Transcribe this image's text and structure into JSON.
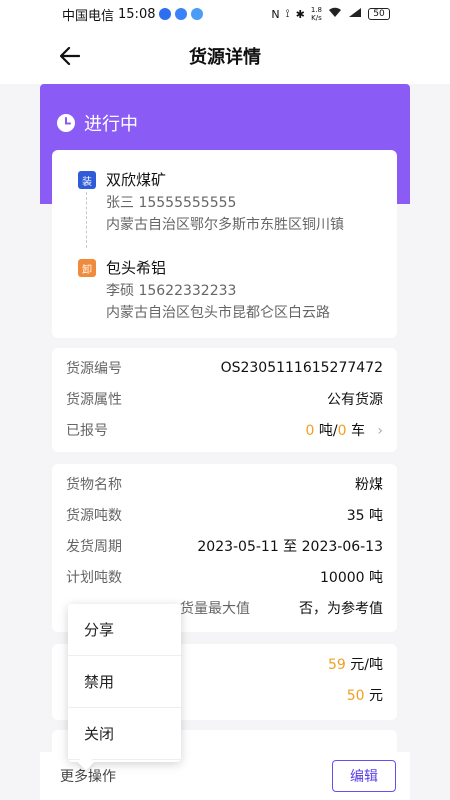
{
  "statusbar": {
    "carrier": "中国电信",
    "time": "15:08",
    "net_speed_top": "1.8",
    "net_speed_bottom": "K/s",
    "battery": "50"
  },
  "header": {
    "title": "货源详情"
  },
  "status": {
    "label": "进行中",
    "banner_color": "#8a5cf5"
  },
  "route": {
    "load": {
      "tag": "装",
      "name": "双欣煤矿",
      "contact": "张三 15555555555",
      "address": "内蒙古自治区鄂尔多斯市东胜区铜川镇"
    },
    "unload": {
      "tag": "卸",
      "name": "包头希铝",
      "contact": "李硕 15622332233",
      "address": "内蒙古自治区包头市昆都仑区白云路"
    }
  },
  "source_info": {
    "number_label": "货源编号",
    "number_value": "OS2305111615277472",
    "attr_label": "货源属性",
    "attr_value": "公有货源",
    "reported_label": "已报号",
    "reported_tons": "0",
    "reported_tons_unit": "吨",
    "reported_sep": "/",
    "reported_cars": "0",
    "reported_cars_unit": "车"
  },
  "goods_info": {
    "name_label": "货物名称",
    "name_value": "粉煤",
    "tons_label": "货源吨数",
    "tons_value": "35 吨",
    "period_label": "发货周期",
    "period_value": "2023-05-11 至 2023-06-13",
    "plan_label": "计划吨数",
    "plan_value": "10000 吨",
    "max_label": "货量最大值",
    "max_value": "否，为参考值"
  },
  "price_info": {
    "unit_price": "59",
    "unit_price_unit": "元/吨",
    "total": "50",
    "total_unit": "元"
  },
  "popup_menu": {
    "items": [
      "分享",
      "禁用",
      "关闭"
    ]
  },
  "bottombar": {
    "more_label": "更多操作",
    "edit_label": "编辑"
  }
}
